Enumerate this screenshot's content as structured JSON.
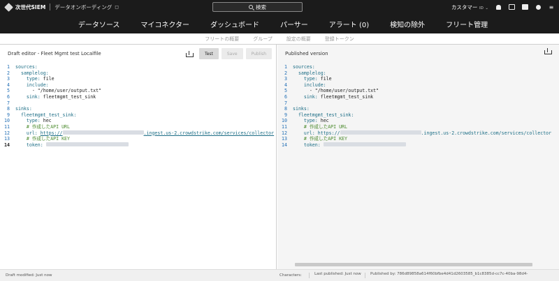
{
  "topbar": {
    "brand": "次世代SIEM",
    "context": "データオンボーディング",
    "context_icon": "bookmark-icon",
    "search_label": "検索",
    "customer_label": "カスタマー",
    "customer_sub": "ID",
    "customer_chevron": "⌄"
  },
  "nav": {
    "items": [
      "データソース",
      "マイコネクター",
      "ダッシュボード",
      "パーサー",
      "アラート (0)",
      "検知の除外",
      "フリート管理"
    ]
  },
  "subtabs": [
    "フリートの概要",
    "グループ",
    "設定の概要",
    "登録トークン"
  ],
  "left": {
    "title": "Draft editor - Fleet Mgmt test Localfile",
    "buttons": {
      "test": "Test",
      "save": "Save",
      "publish": "Publish"
    }
  },
  "right": {
    "title": "Published version"
  },
  "code": {
    "l1": "sources:",
    "l2": "samplelog:",
    "l3k": "type:",
    "l3v": " file",
    "l4": "include:",
    "l5": "- \"/home/user/output.txt\"",
    "l6k": "sink:",
    "l6v": " fleetmgmt_test_sink",
    "l8": "sinks:",
    "l9": "fleetmgmt_test_sink:",
    "l10k": "type:",
    "l10v": " hec",
    "l11": "# 作成したAPI URL",
    "l12k": "url:",
    "l12a": "https://",
    "l12b": ".ingest.us-2.crowdstrike.com/services/collector",
    "l13": "# 作成したAPI KEY",
    "l14k": "token:",
    "line_numbers": [
      "1",
      "2",
      "3",
      "4",
      "5",
      "6",
      "7",
      "8",
      "9",
      "10",
      "11",
      "12",
      "13",
      "14"
    ]
  },
  "status": {
    "draft": "Draft modified: Just now",
    "characters": "Characters:",
    "characters_val": "",
    "last_published": "Last published: Just now",
    "published_by": "Published by: 786d89858a614f60bfbe4d41d2603585_b1c8385d-cc7c-40ba-98d4-"
  }
}
